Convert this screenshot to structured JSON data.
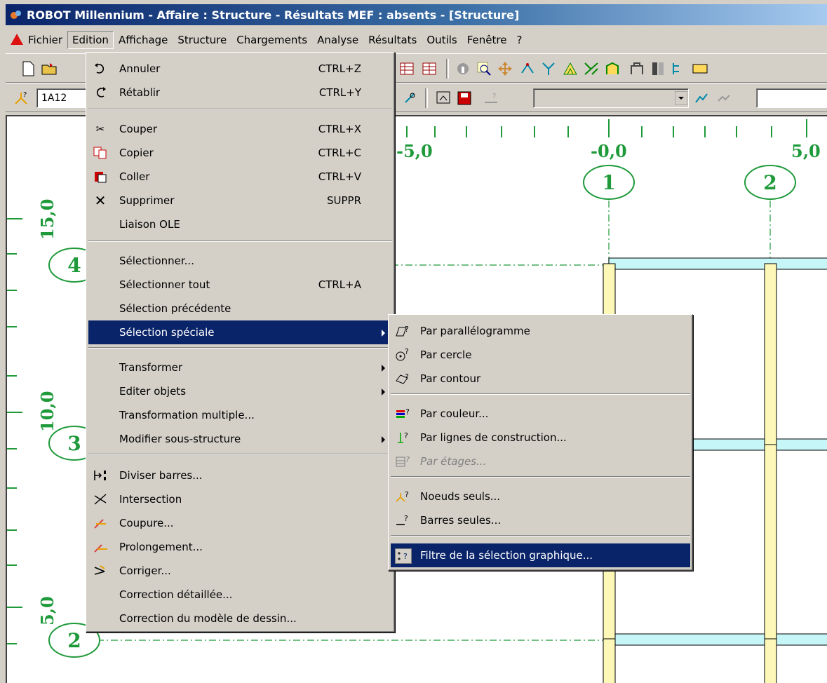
{
  "title_bar": {
    "title": "ROBOT Millennium - Affaire : Structure - Résultats MEF : absents - [Structure]"
  },
  "menu_bar": [
    "Fichier",
    "Edition",
    "Affichage",
    "Structure",
    "Chargements",
    "Analyse",
    "Résultats",
    "Outils",
    "Fenêtre",
    "?"
  ],
  "toolbar2": {
    "selection_field": "1A12"
  },
  "edition_menu": {
    "items": [
      {
        "label": "Annuler",
        "shortcut": "CTRL+Z",
        "icon": "undo-icon"
      },
      {
        "label": "Rétablir",
        "shortcut": "CTRL+Y",
        "icon": "redo-icon"
      },
      {
        "label": "Couper",
        "shortcut": "CTRL+X",
        "icon": "cut-icon"
      },
      {
        "label": "Copier",
        "shortcut": "CTRL+C",
        "icon": "copy-icon"
      },
      {
        "label": "Coller",
        "shortcut": "CTRL+V",
        "icon": "paste-icon"
      },
      {
        "label": "Supprimer",
        "shortcut": "SUPPR",
        "icon": "delete-icon"
      },
      {
        "label": "Liaison OLE",
        "shortcut": ""
      },
      {
        "label": "Sélectionner...",
        "shortcut": ""
      },
      {
        "label": "Sélectionner tout",
        "shortcut": "CTRL+A"
      },
      {
        "label": "Sélection précédente",
        "shortcut": ""
      },
      {
        "label": "Sélection spéciale",
        "shortcut": "",
        "submenu": true,
        "highlighted": true
      },
      {
        "label": "Transformer",
        "shortcut": "",
        "submenu": true
      },
      {
        "label": "Editer objets",
        "shortcut": "",
        "submenu": true
      },
      {
        "label": "Transformation multiple...",
        "shortcut": ""
      },
      {
        "label": "Modifier sous-structure",
        "shortcut": "",
        "submenu": true
      },
      {
        "label": "Diviser barres...",
        "icon": "divide-bars-icon"
      },
      {
        "label": "Intersection",
        "icon": "intersection-icon"
      },
      {
        "label": "Coupure...",
        "icon": "cut-bars-icon"
      },
      {
        "label": "Prolongement...",
        "icon": "extend-icon"
      },
      {
        "label": "Corriger...",
        "icon": "correct-icon"
      },
      {
        "label": "Correction détaillée..."
      },
      {
        "label": "Correction du modèle de dessin..."
      }
    ]
  },
  "special_selection_submenu": {
    "items": [
      {
        "label": "Par parallélogramme",
        "icon": "parallelogram-select-icon"
      },
      {
        "label": "Par cercle",
        "icon": "circle-select-icon"
      },
      {
        "label": "Par contour",
        "icon": "contour-select-icon"
      },
      {
        "label": "Par couleur...",
        "icon": "color-select-icon"
      },
      {
        "label": "Par lignes de construction...",
        "icon": "construction-lines-icon"
      },
      {
        "label": "Par étages...",
        "icon": "floors-icon",
        "disabled": true
      },
      {
        "label": "Noeuds seuls...",
        "icon": "nodes-only-icon"
      },
      {
        "label": "Barres seules...",
        "icon": "bars-only-icon"
      },
      {
        "label": "Filtre de la sélection graphique...",
        "icon": "filter-icon",
        "highlighted": true
      }
    ]
  },
  "drawing": {
    "x_ticks": [
      "-5,0",
      "-0,0",
      "5,0"
    ],
    "y_ticks": [
      "15,0",
      "10,0",
      "5,0"
    ],
    "grid_columns": [
      "1",
      "2"
    ],
    "grid_rows": [
      "4",
      "3",
      "2"
    ]
  }
}
